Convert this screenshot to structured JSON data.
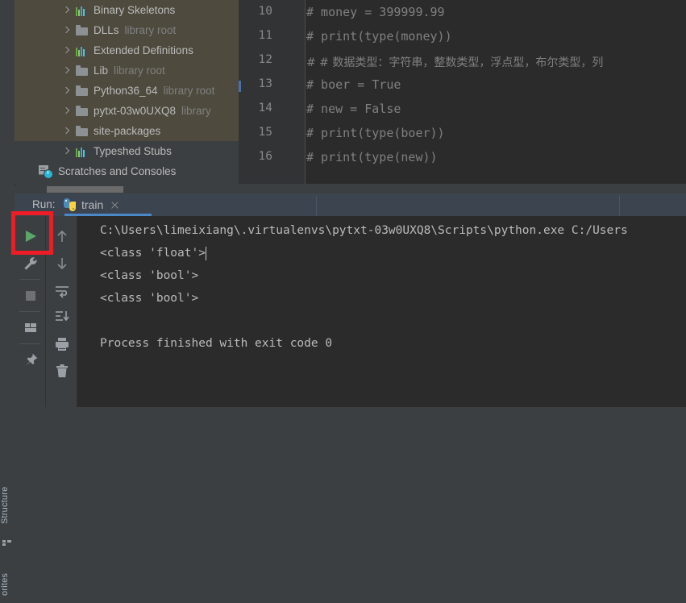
{
  "project_tree": {
    "rows": [
      {
        "label": "Binary Skeletons",
        "suffix": "",
        "icon": "library-bars-icon",
        "selected": true
      },
      {
        "label": "DLLs",
        "suffix": "library root",
        "icon": "folder-icon",
        "selected": true
      },
      {
        "label": "Extended Definitions",
        "suffix": "",
        "icon": "library-bars-icon",
        "selected": true
      },
      {
        "label": "Lib",
        "suffix": "library root",
        "icon": "folder-icon",
        "selected": true
      },
      {
        "label": "Python36_64",
        "suffix": "library root",
        "icon": "folder-icon",
        "selected": true
      },
      {
        "label": "pytxt-03w0UXQ8",
        "suffix": "library",
        "icon": "folder-icon",
        "selected": true
      },
      {
        "label": "site-packages",
        "suffix": "",
        "icon": "folder-icon",
        "selected": true
      },
      {
        "label": "Typeshed Stubs",
        "suffix": "",
        "icon": "library-bars-icon",
        "selected": false
      }
    ],
    "scratches": "Scratches and Consoles"
  },
  "side_tabs": {
    "structure": "Structure",
    "favorites": "orites"
  },
  "editor": {
    "lines": [
      {
        "number": "10",
        "text": "# money = 399999.99",
        "cjk": false
      },
      {
        "number": "11",
        "text": "# print(type(money))",
        "cjk": false
      },
      {
        "number": "12",
        "text": "# # 数据类型：字符串，整数类型，浮点型，布尔类型，列",
        "cjk": true
      },
      {
        "number": "13",
        "text": "# boer = True",
        "cjk": false
      },
      {
        "number": "14",
        "text": "# new = False",
        "cjk": false
      },
      {
        "number": "15",
        "text": "# print(type(boer))",
        "cjk": false
      },
      {
        "number": "16",
        "text": "# print(type(new))",
        "cjk": false
      }
    ]
  },
  "run_window": {
    "label": "Run:",
    "tab_name": "train",
    "tab_icon": "python-icon",
    "close_icon": "close-icon",
    "toolbar_left": [
      {
        "name": "run-button",
        "icon": "play-icon"
      },
      {
        "name": "settings-button",
        "icon": "wrench-icon"
      },
      {
        "name": "stop-button",
        "icon": "stop-square-icon"
      },
      {
        "name": "layout-button",
        "icon": "layout-icon"
      },
      {
        "name": "pin-button",
        "icon": "pin-icon"
      }
    ],
    "toolbar_right": [
      {
        "name": "up-button",
        "icon": "arrow-up-icon"
      },
      {
        "name": "down-button",
        "icon": "arrow-down-icon"
      },
      {
        "name": "soft-wrap-button",
        "icon": "soft-wrap-icon"
      },
      {
        "name": "scroll-to-end-button",
        "icon": "scroll-end-icon"
      },
      {
        "name": "print-button",
        "icon": "printer-icon"
      },
      {
        "name": "clear-button",
        "icon": "trash-icon"
      }
    ],
    "console": [
      "C:\\Users\\limeixiang\\.virtualenvs\\pytxt-03w0UXQ8\\Scripts\\python.exe C:/Users",
      "<class 'float'>",
      "<class 'bool'>",
      "<class 'bool'>",
      "",
      "Process finished with exit code 0"
    ]
  },
  "annotation": {
    "highlight_color": "#ee1c25",
    "target": "run-button"
  }
}
